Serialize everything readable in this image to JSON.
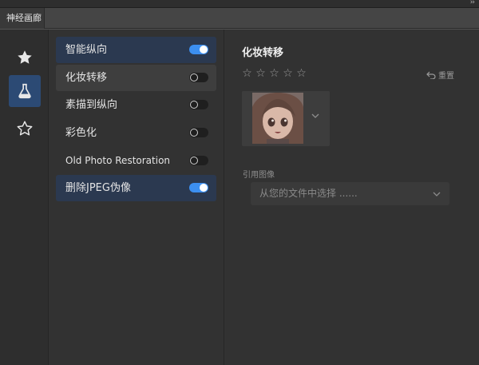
{
  "window": {
    "panel_tab_title": "神经画廊",
    "collapse_icon": "double-chevron-right-icon"
  },
  "sidebar": {
    "items": [
      {
        "name": "featured",
        "icon": "star-filled-icon",
        "active": false
      },
      {
        "name": "beta",
        "icon": "flask-icon",
        "active": true
      },
      {
        "name": "wishlist",
        "icon": "star-outline-icon",
        "active": false
      }
    ]
  },
  "filters": {
    "items": [
      {
        "label": "智能纵向",
        "enabled": true,
        "highlight": "selected"
      },
      {
        "label": "化妆转移",
        "enabled": false,
        "highlight": "hover"
      },
      {
        "label": "素描到纵向",
        "enabled": false,
        "highlight": "none"
      },
      {
        "label": "彩色化",
        "enabled": false,
        "highlight": "none"
      },
      {
        "label": "Old Photo Restoration",
        "enabled": false,
        "highlight": "none"
      },
      {
        "label": "删除JPEG伪像",
        "enabled": true,
        "highlight": "selected"
      }
    ]
  },
  "detail": {
    "title": "化妆转移",
    "rating": {
      "max": 5,
      "value": 0
    },
    "reset_label": "重置",
    "reference_label": "引用图像",
    "select_placeholder": "从您的文件中选择 ......"
  },
  "colors": {
    "accent": "#3c8ff0",
    "active_sidebar": "#2c4a74",
    "selected_row": "#2b3950",
    "panel_bg": "#323232"
  }
}
